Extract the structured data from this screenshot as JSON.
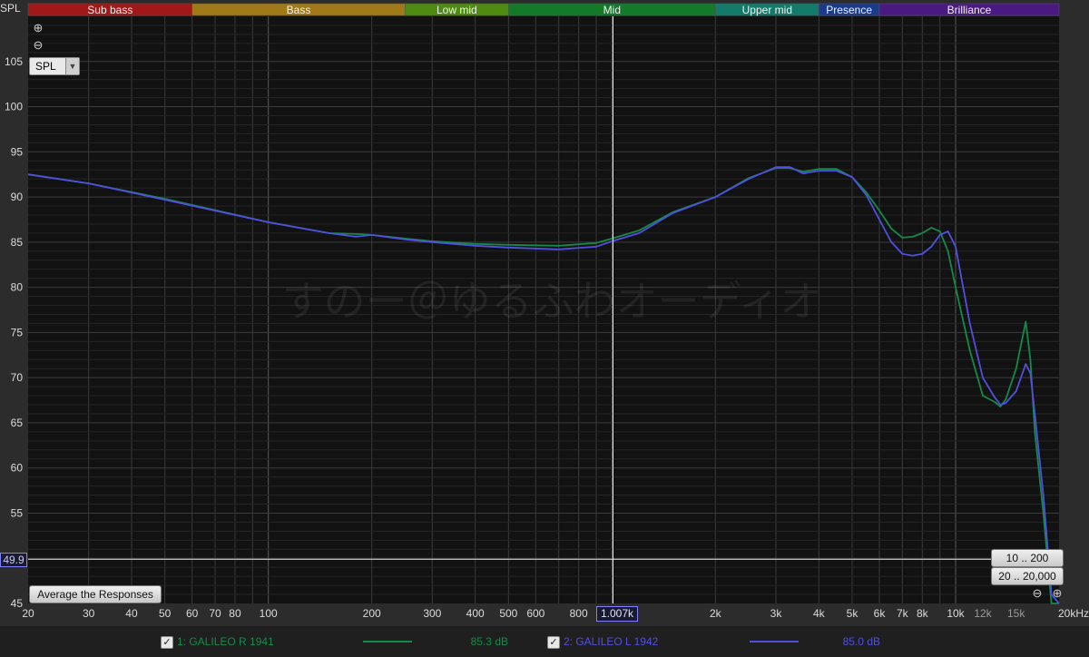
{
  "bands": [
    {
      "label": "Sub bass",
      "from": 20,
      "to": 60,
      "color": "#a01818"
    },
    {
      "label": "Bass",
      "from": 60,
      "to": 250,
      "color": "#a07a18"
    },
    {
      "label": "Low mid",
      "from": 250,
      "to": 500,
      "color": "#4f8a12"
    },
    {
      "label": "Mid",
      "from": 500,
      "to": 2000,
      "color": "#147a2a"
    },
    {
      "label": "Upper mid",
      "from": 2000,
      "to": 4000,
      "color": "#147a6a"
    },
    {
      "label": "Presence",
      "from": 4000,
      "to": 6000,
      "color": "#1a3a8a"
    },
    {
      "label": "Brilliance",
      "from": 6000,
      "to": 20000,
      "color": "#4a1a80"
    }
  ],
  "y_axis_label": "SPL",
  "watermark": "すのー＠ゆるふわオーディオ",
  "selector": {
    "value": "SPL"
  },
  "zoom_in_icon": "⊕",
  "zoom_out_icon": "⊖",
  "cursor": {
    "frequency_label": "1.007k",
    "level_label": "49.9",
    "frequency": 1007,
    "level": 49.9
  },
  "buttons": {
    "average": "Average the Responses",
    "range_low": "10 .. 200",
    "range_full": "20 .. 20,000"
  },
  "legend": [
    {
      "checked": "✓",
      "name": "1: GALILEO R 1941",
      "value": "85.3 dB",
      "color": "#148a48"
    },
    {
      "checked": "✓",
      "name": "2: GALILEO L 1942",
      "value": "85.0 dB",
      "color": "#5050e0"
    }
  ],
  "chart_data": {
    "type": "line",
    "xscale": "log",
    "xlim": [
      20,
      20000
    ],
    "ylim": [
      45,
      110
    ],
    "x_ticks": [
      {
        "f": 20,
        "label": "20"
      },
      {
        "f": 30,
        "label": "30"
      },
      {
        "f": 40,
        "label": "40"
      },
      {
        "f": 50,
        "label": "50"
      },
      {
        "f": 60,
        "label": "60"
      },
      {
        "f": 70,
        "label": "70"
      },
      {
        "f": 80,
        "label": "80"
      },
      {
        "f": 100,
        "label": "100"
      },
      {
        "f": 200,
        "label": "200"
      },
      {
        "f": 300,
        "label": "300"
      },
      {
        "f": 400,
        "label": "400"
      },
      {
        "f": 500,
        "label": "500"
      },
      {
        "f": 600,
        "label": "600"
      },
      {
        "f": 800,
        "label": "800"
      },
      {
        "f": 2000,
        "label": "2k"
      },
      {
        "f": 3000,
        "label": "3k"
      },
      {
        "f": 4000,
        "label": "4k"
      },
      {
        "f": 5000,
        "label": "5k"
      },
      {
        "f": 6000,
        "label": "6k"
      },
      {
        "f": 7000,
        "label": "7k"
      },
      {
        "f": 8000,
        "label": "8k"
      },
      {
        "f": 10000,
        "label": "10k"
      },
      {
        "f": 12000,
        "label": "12k"
      },
      {
        "f": 15000,
        "label": "15k"
      },
      {
        "f": 20000,
        "label": "20kHz"
      }
    ],
    "y_ticks": [
      50,
      55,
      60,
      65,
      70,
      75,
      80,
      85,
      90,
      95,
      100,
      105
    ],
    "y_tick_labels": [
      "45",
      "55",
      "60",
      "65",
      "70",
      "75",
      "80",
      "85",
      "90",
      "95",
      "100",
      "105"
    ],
    "series": [
      {
        "name": "1: GALILEO R 1941",
        "color": "#148a48",
        "x": [
          20,
          30,
          50,
          100,
          150,
          180,
          200,
          250,
          300,
          400,
          500,
          700,
          900,
          1000,
          1200,
          1500,
          2000,
          2500,
          3000,
          3300,
          3600,
          4000,
          4500,
          5000,
          5500,
          6000,
          6500,
          7000,
          7500,
          8000,
          8500,
          9000,
          9500,
          10000,
          11000,
          12000,
          13000,
          13500,
          14000,
          15000,
          16000,
          16500,
          17000,
          18000,
          19000,
          20000
        ],
        "y": [
          92.5,
          91.5,
          89.8,
          87.2,
          86.0,
          85.9,
          85.8,
          85.4,
          85.1,
          84.8,
          84.7,
          84.6,
          84.9,
          85.4,
          86.3,
          88.3,
          90.0,
          92.1,
          93.2,
          93.2,
          92.8,
          93.1,
          93.1,
          92.2,
          90.5,
          88.5,
          86.5,
          85.5,
          85.6,
          86.0,
          86.6,
          86.2,
          84.0,
          80.0,
          73.0,
          68.0,
          67.3,
          66.8,
          67.6,
          71.0,
          76.2,
          72.0,
          64.0,
          55.0,
          45.0,
          45.0
        ]
      },
      {
        "name": "2: GALILEO L 1942",
        "color": "#5050e0",
        "x": [
          20,
          30,
          50,
          100,
          150,
          180,
          200,
          250,
          300,
          400,
          500,
          700,
          900,
          1000,
          1200,
          1500,
          2000,
          2500,
          3000,
          3300,
          3600,
          4000,
          4500,
          5000,
          5500,
          6000,
          6500,
          7000,
          7500,
          8000,
          8500,
          9000,
          9500,
          10000,
          11000,
          12000,
          13000,
          13500,
          14000,
          15000,
          16000,
          16500,
          17000,
          18000,
          19000,
          20000
        ],
        "y": [
          92.5,
          91.5,
          89.7,
          87.2,
          86.0,
          85.6,
          85.8,
          85.3,
          85.0,
          84.6,
          84.4,
          84.2,
          84.5,
          85.1,
          86.0,
          88.2,
          90.0,
          92.0,
          93.3,
          93.3,
          92.6,
          92.9,
          92.9,
          92.2,
          90.2,
          87.5,
          85.0,
          83.7,
          83.5,
          83.7,
          84.5,
          85.8,
          86.2,
          84.5,
          76.0,
          70.0,
          67.8,
          67.0,
          67.2,
          68.5,
          71.5,
          70.5,
          66.0,
          57.0,
          46.0,
          45.0
        ]
      }
    ]
  }
}
